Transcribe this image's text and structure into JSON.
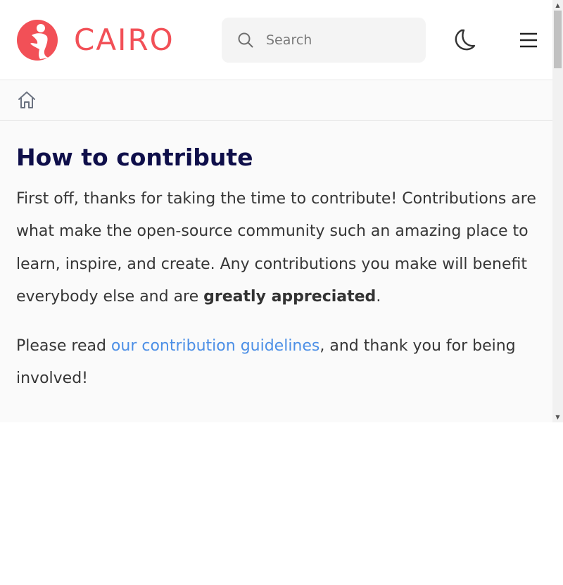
{
  "header": {
    "logo_text": "CAIRO",
    "search_placeholder": "Search",
    "brand_color": "#f25057",
    "icons": {
      "logo": "cairo-runner-logo-icon",
      "search": "search-icon",
      "theme": "moon-icon",
      "menu": "hamburger-menu-icon"
    }
  },
  "breadcrumb": {
    "icon": "home-icon"
  },
  "article": {
    "title": "How to contribute",
    "p1_text_a": "First off, thanks for taking the time to contribute! Contributions are what make the open-source community such an amazing place to learn, inspire, and create. Any contributions you make will benefit everybody else and are ",
    "p1_strong": "greatly appreciated",
    "p1_text_b": ".",
    "p2_text_a": "Please read ",
    "p2_link": "our contribution guidelines",
    "p2_text_b": ", and thank you for being involved!",
    "link_color": "#4c8fe6",
    "title_color": "#0f0f4a"
  },
  "scrollbar": {
    "up_glyph": "▲",
    "down_glyph": "▼"
  }
}
